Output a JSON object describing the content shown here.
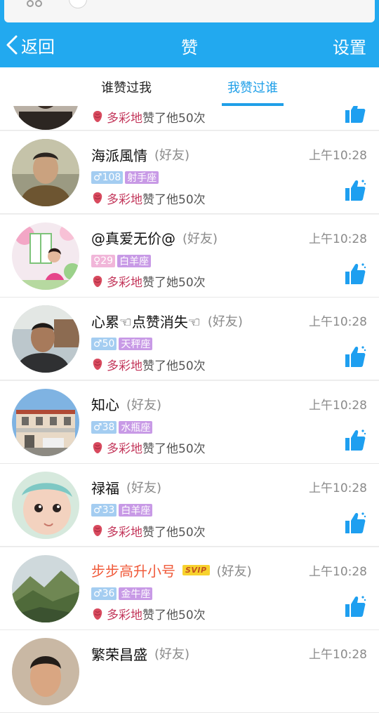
{
  "nav": {
    "back_label": "返回",
    "title": "赞",
    "settings_label": "设置"
  },
  "tabs": [
    {
      "label": "谁赞过我",
      "active": false
    },
    {
      "label": "我赞过谁",
      "active": true
    }
  ],
  "colors": {
    "brand_blue": "#22a9ef",
    "tab_active": "#1f9fe8",
    "giver_name": "#c3375b"
  },
  "partial_row": {
    "giver": "多彩地",
    "suffix": "赞了他50次"
  },
  "rows": [
    {
      "name": "海派風情",
      "friend": "(好友)",
      "time": "上午10:28",
      "gender": "male",
      "gender_icon": "♂",
      "age": "108",
      "zodiac": "射手座",
      "giver": "多彩地",
      "suffix": "赞了他50次",
      "avatar": "man-portrait",
      "svip": ""
    },
    {
      "name": "@真爱无价@",
      "friend": "(好友)",
      "time": "上午10:28",
      "gender": "female",
      "gender_icon": "♀",
      "age": "29",
      "zodiac": "白羊座",
      "giver": "多彩地",
      "suffix": "赞了她50次",
      "avatar": "woman-garden",
      "svip": ""
    },
    {
      "name": "心累☜点赞消失☜",
      "friend": "(好友)",
      "time": "上午10:28",
      "gender": "male",
      "gender_icon": "♂",
      "age": "50",
      "zodiac": "天秤座",
      "giver": "多彩地",
      "suffix": "赞了他50次",
      "avatar": "man-outdoor",
      "svip": ""
    },
    {
      "name": "知心",
      "friend": "(好友)",
      "time": "上午10:28",
      "gender": "male",
      "gender_icon": "♂",
      "age": "38",
      "zodiac": "水瓶座",
      "giver": "多彩地",
      "suffix": "赞了他50次",
      "avatar": "building",
      "svip": ""
    },
    {
      "name": "禄福",
      "friend": "(好友)",
      "time": "上午10:28",
      "gender": "male",
      "gender_icon": "♂",
      "age": "33",
      "zodiac": "白羊座",
      "giver": "多彩地",
      "suffix": "赞了他50次",
      "avatar": "baby",
      "svip": ""
    },
    {
      "name": "步步高升小号",
      "friend": "(好友)",
      "time": "上午10:28",
      "gender": "male",
      "gender_icon": "♂",
      "age": "36",
      "zodiac": "金牛座",
      "giver": "多彩地",
      "suffix": "赞了他50次",
      "avatar": "mountains",
      "svip": "SVIP"
    },
    {
      "name": "繁荣昌盛",
      "friend": "(好友)",
      "time": "上午10:28",
      "gender": "male",
      "gender_icon": "♂",
      "age": "",
      "zodiac": "",
      "giver": "",
      "suffix": "",
      "avatar": "man-portrait-2",
      "svip": ""
    }
  ]
}
